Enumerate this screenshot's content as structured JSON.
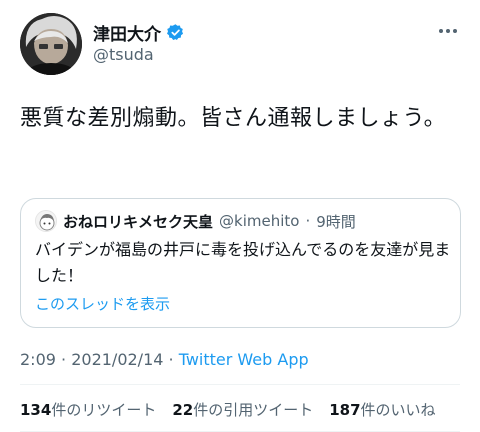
{
  "author": {
    "display_name": "津田大介",
    "handle": "@tsuda",
    "verified": true
  },
  "tweet": {
    "text": "悪質な差別煽動。皆さん通報しましょう。"
  },
  "quote": {
    "display_name": "おねロリキメセク天皇",
    "handle": "@kimehito",
    "separator": "·",
    "time": "9時間",
    "text": "バイデンが福島の井戸に毒を投げ込んでるのを友達が見ました！",
    "thread_link": "このスレッドを表示"
  },
  "meta": {
    "time": "2:09",
    "sep1": " · ",
    "date": "2021/02/14",
    "sep2": " · ",
    "source": "Twitter Web App"
  },
  "stats": {
    "retweets": {
      "count": "134",
      "label": "件のリツイート"
    },
    "quotes": {
      "count": "22",
      "label": "件の引用ツイート"
    },
    "likes": {
      "count": "187",
      "label": "件のいいね"
    }
  },
  "colors": {
    "link": "#1d9bf0",
    "secondary_text": "#536471",
    "border": "#cfd9de",
    "verified_badge": "#1d9bf0"
  },
  "icons": {
    "verified": "verified-badge-icon",
    "more": "more-options-icon"
  }
}
